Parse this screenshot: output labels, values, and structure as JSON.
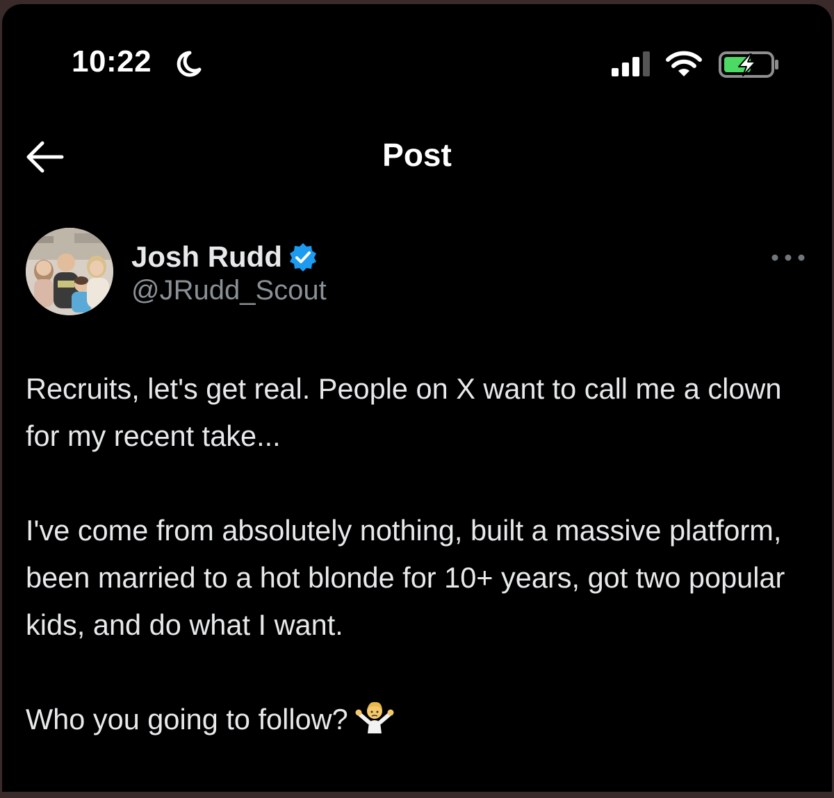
{
  "status_bar": {
    "time": "10:22",
    "moon_icon": "moon-icon",
    "signal_icon": "signal-icon",
    "wifi_icon": "wifi-icon",
    "battery_icon": "battery-charging-icon",
    "battery_color": "#4cd964"
  },
  "header": {
    "back_icon": "arrow-left-icon",
    "title": "Post"
  },
  "post": {
    "author": {
      "name": "Josh Rudd",
      "handle": "@JRudd_Scout",
      "verified": true,
      "verified_color": "#1d9bf0",
      "avatar_icon": "avatar-photo"
    },
    "more_icon": "more-dots-icon",
    "paragraphs": [
      "Recruits, let's get real. People on X want to call me a clown for my recent take...",
      "I've come from absolutely nothing, built a massive platform, been married to a hot blonde for 10+ years, got two popular kids, and do what I want.",
      "Who you going to follow?"
    ],
    "trailing_emoji": "person-shrugging-emoji"
  }
}
